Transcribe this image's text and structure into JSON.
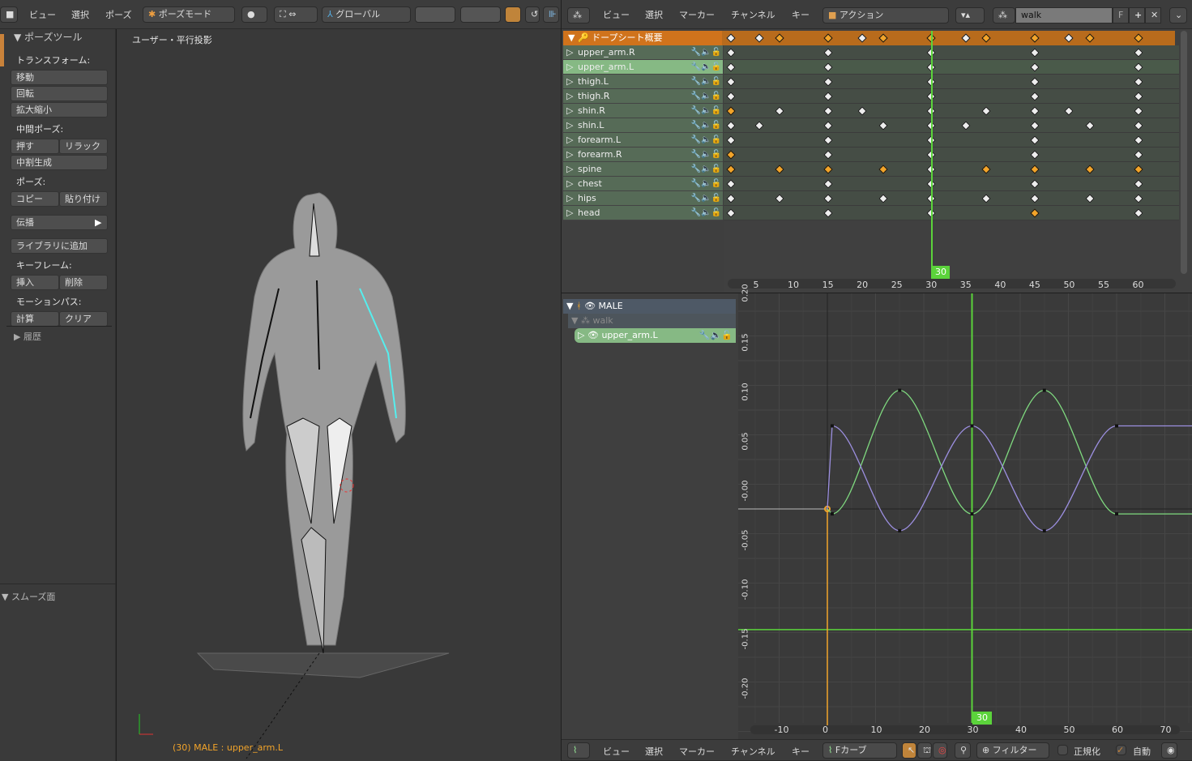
{
  "viewport_header": {
    "menus": [
      "ビュー",
      "選択",
      "ポーズ"
    ],
    "mode": "ポーズモード",
    "orientation": "グローバル"
  },
  "viewport": {
    "title": "ユーザー・平行投影",
    "status": "(30) MALE : upper_arm.L"
  },
  "toolshelf": {
    "title": "ポーズツール",
    "sections": [
      {
        "label": "トランスフォーム:",
        "rows": [
          [
            "移動"
          ],
          [
            "回転"
          ],
          [
            "拡大縮小"
          ]
        ]
      },
      {
        "label": "中間ポーズ:",
        "rows": [
          [
            "押す",
            "リラック"
          ],
          [
            "中割生成"
          ]
        ]
      },
      {
        "label": "ポーズ:",
        "rows": [
          [
            "コピー",
            "貼り付け"
          ]
        ]
      },
      {
        "label": "",
        "rows": [
          [
            "伝播"
          ]
        ]
      },
      {
        "label": "",
        "rows": [
          [
            "ライブラリに追加"
          ]
        ]
      },
      {
        "label": "キーフレーム:",
        "rows": [
          [
            "挿入",
            "削除"
          ]
        ]
      },
      {
        "label": "モーションパス:",
        "rows": [
          [
            "計算",
            "クリア"
          ]
        ]
      }
    ],
    "history": "履歴",
    "smooth": "スムーズ面"
  },
  "dopesheet": {
    "menus": [
      "ビュー",
      "選択",
      "マーカー",
      "チャンネル",
      "キー"
    ],
    "mode": "アクション",
    "action": "walk",
    "fake_user": "F",
    "summary": "ドープシート概要",
    "current_frame": 30,
    "ticks": [
      5,
      10,
      15,
      20,
      25,
      30,
      35,
      40,
      45,
      50,
      55,
      60
    ],
    "channels": [
      {
        "name": "upper_arm.R",
        "keys": [
          1,
          15,
          30,
          45,
          60
        ],
        "selected": []
      },
      {
        "name": "upper_arm.L",
        "keys": [
          1,
          15,
          30,
          45,
          60
        ],
        "selected": [],
        "active": true
      },
      {
        "name": "thigh.L",
        "keys": [
          1,
          15,
          30,
          45,
          60
        ],
        "selected": []
      },
      {
        "name": "thigh.R",
        "keys": [
          1,
          15,
          30,
          45,
          60
        ],
        "selected": []
      },
      {
        "name": "shin.R",
        "keys": [
          1,
          8,
          15,
          20,
          30,
          38,
          45,
          50,
          60
        ],
        "selected": [
          1
        ]
      },
      {
        "name": "shin.L",
        "keys": [
          1,
          5,
          15,
          23,
          30,
          35,
          45,
          53,
          60
        ],
        "selected": []
      },
      {
        "name": "forearm.L",
        "keys": [
          1,
          15,
          30,
          45,
          60
        ],
        "selected": []
      },
      {
        "name": "forearm.R",
        "keys": [
          1,
          15,
          30,
          45,
          60
        ],
        "selected": [
          1
        ]
      },
      {
        "name": "spine",
        "keys": [
          1,
          8,
          15,
          23,
          30,
          38,
          45,
          53,
          60
        ],
        "selected": [
          1,
          8,
          15,
          23,
          38,
          45,
          53,
          60
        ]
      },
      {
        "name": "chest",
        "keys": [
          1,
          15,
          30,
          45,
          60
        ],
        "selected": []
      },
      {
        "name": "hips",
        "keys": [
          1,
          8,
          15,
          23,
          30,
          38,
          45,
          53,
          60
        ],
        "selected": []
      },
      {
        "name": "head",
        "keys": [
          1,
          15,
          30,
          45,
          60
        ],
        "selected": [
          45
        ]
      }
    ],
    "summary_keys": [
      1,
      5,
      8,
      15,
      20,
      23,
      30,
      35,
      38,
      45,
      50,
      53,
      60
    ],
    "summary_selected": [
      8,
      15,
      23,
      30,
      38,
      45,
      53,
      60
    ]
  },
  "graph": {
    "menus": [
      "ビュー",
      "選択",
      "マーカー",
      "チャンネル",
      "キー"
    ],
    "mode": "Fカーブ",
    "filter": "フィルター",
    "normalize": "正規化",
    "auto": "自動",
    "tree": {
      "object": "MALE",
      "action": "walk",
      "channel": "upper_arm.L"
    },
    "current_frame": 30,
    "cursor_value": -0.122,
    "xticks": [
      -10,
      0,
      10,
      20,
      30,
      40,
      50,
      60,
      70
    ],
    "yticks": [
      "0.20",
      "0.15",
      "0.10",
      "0.05",
      "-0.00",
      "-0.05",
      "-0.10",
      "-0.15",
      "-0.20"
    ],
    "curves": [
      {
        "color": "#7fd97f",
        "keys": [
          [
            1,
            -0.005
          ],
          [
            15,
            0.12
          ],
          [
            30,
            -0.005
          ],
          [
            45,
            0.12
          ],
          [
            60,
            -0.005
          ]
        ]
      },
      {
        "color": "#9c8fe0",
        "keys": [
          [
            1,
            0.084
          ],
          [
            15,
            -0.022
          ],
          [
            30,
            0.084
          ],
          [
            45,
            -0.022
          ],
          [
            60,
            0.084
          ]
        ]
      }
    ],
    "colors": {
      "accent": "#f2a42a",
      "frame": "#5bd33b",
      "channel": "#86b984"
    }
  }
}
